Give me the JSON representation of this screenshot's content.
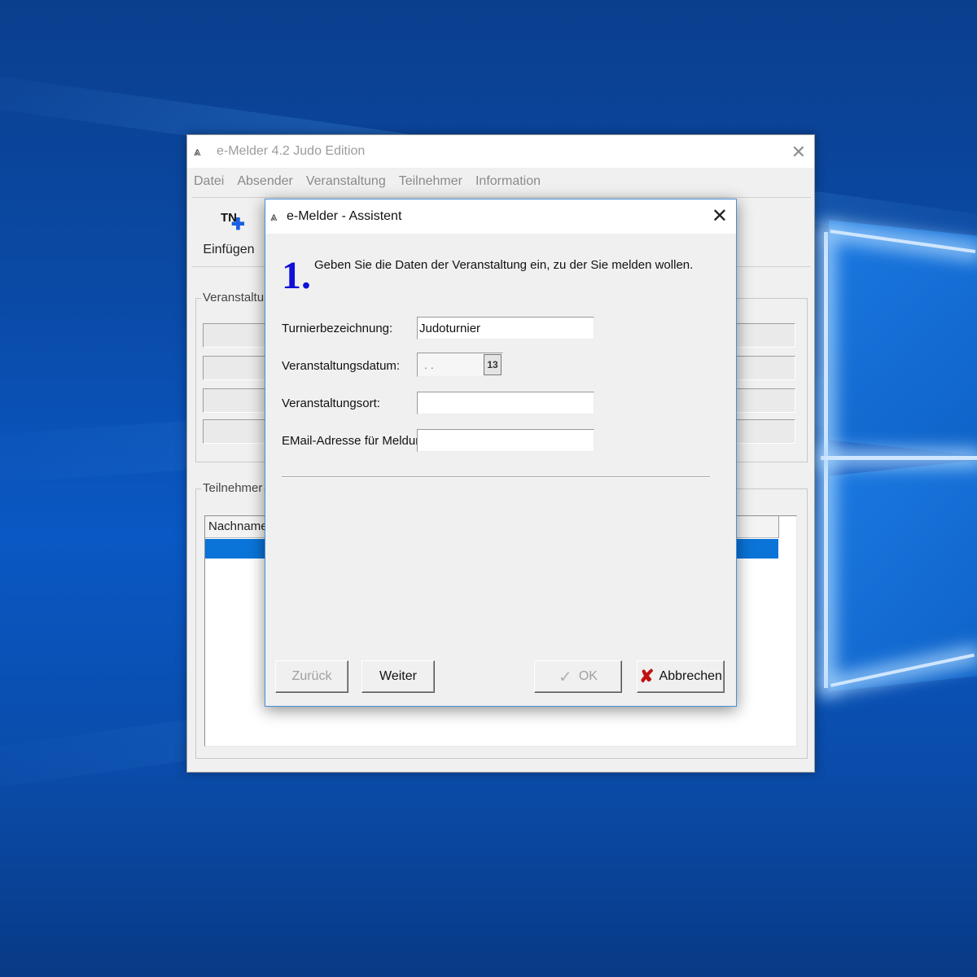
{
  "main_window": {
    "title": "e-Melder 4.2 Judo Edition",
    "close_glyph": "✕",
    "menu": [
      "Datei",
      "Absender",
      "Veranstaltung",
      "Teilnehmer",
      "Information"
    ],
    "toolbar": {
      "insert_icon_text": "TN",
      "insert_label": "Einfügen"
    },
    "group_event_label": "Veranstaltung",
    "group_participants_label": "Teilnehmer",
    "list_column": "Nachname"
  },
  "dialog": {
    "title": "e-Melder - Assistent",
    "close_glyph": "✕",
    "step_number": "1.",
    "instruction": "Geben Sie die Daten der Veranstaltung ein, zu der Sie melden wollen.",
    "fields": {
      "tournament_label": "Turnierbezeichnung:",
      "tournament_value": "Judoturnier",
      "date_label": "Veranstaltungsdatum:",
      "date_value": ". .",
      "date_button": "13",
      "location_label": "Veranstaltungsort:",
      "location_value": "",
      "email_label": "EMail-Adresse für Meldung:",
      "email_value": ""
    },
    "buttons": {
      "back": "Zurück",
      "next": "Weiter",
      "ok": "OK",
      "cancel": "Abbrechen"
    }
  },
  "colors": {
    "accent_blue": "#0a74d8",
    "step_number": "#1010d8",
    "cancel_red": "#c01010"
  }
}
